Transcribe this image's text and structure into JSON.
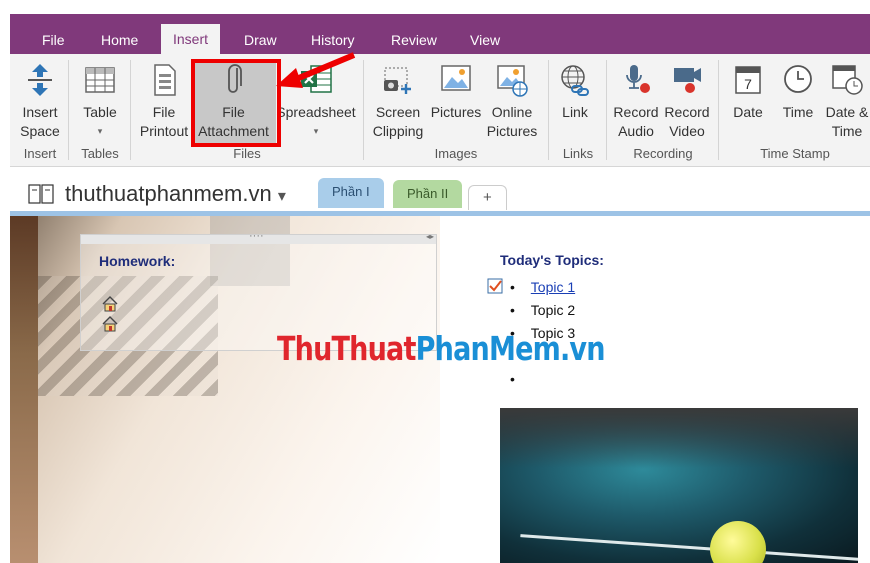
{
  "ribbon_tabs": [
    "File",
    "Home",
    "Insert",
    "Draw",
    "History",
    "Review",
    "View"
  ],
  "ribbon": {
    "buttons": {
      "insert_space": [
        "Insert",
        "Space"
      ],
      "table": [
        "Table",
        "▾"
      ],
      "file_printout": [
        "File",
        "Printout"
      ],
      "file_attachment": [
        "File",
        "Attachment"
      ],
      "spreadsheet": [
        "Spreadsheet",
        "▾"
      ],
      "screen_clipping": [
        "Screen",
        "Clipping"
      ],
      "pictures": [
        "Pictures",
        ""
      ],
      "online_pictures": [
        "Online",
        "Pictures"
      ],
      "link": [
        "Link",
        ""
      ],
      "record_audio": [
        "Record",
        "Audio"
      ],
      "record_video": [
        "Record",
        "Video"
      ],
      "date": [
        "Date",
        ""
      ],
      "time": [
        "Time",
        ""
      ],
      "date_time": [
        "Date &",
        "Time"
      ]
    },
    "groups": {
      "insert": "Insert",
      "tables": "Tables",
      "files": "Files",
      "images": "Images",
      "links": "Links",
      "recording": "Recording",
      "time_stamp": "Time Stamp"
    },
    "date_icon_number": "7"
  },
  "notebook": {
    "name": "thuthuatphanmem.vn",
    "dropdown": "▾",
    "sections": [
      "Phần I",
      "Phần II"
    ],
    "add_section": "+"
  },
  "page": {
    "homework_title": "Homework:",
    "homework_grip": "····",
    "homework_resize": "◂▸",
    "topics_title": "Today's Topics:",
    "topics": [
      "Topic 1",
      "Topic 2",
      "Topic 3",
      ""
    ],
    "watermark": {
      "part1": "ThuThuat",
      "part2": "PhanMem",
      "part3": ".vn"
    }
  },
  "colors": {
    "accent": "#80397b",
    "watermark_red": "#e0262d",
    "watermark_blue": "#1a8fd6",
    "highlight_red": "#ee0000"
  }
}
